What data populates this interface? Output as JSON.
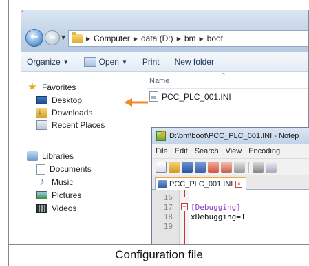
{
  "caption": "Configuration file",
  "explorer": {
    "breadcrumb": [
      "Computer",
      "data (D:)",
      "bm",
      "boot"
    ],
    "toolbar": {
      "organize": "Organize",
      "open": "Open",
      "print": "Print",
      "new_folder": "New folder"
    },
    "nav": {
      "favorites_header": "Favorites",
      "favorites": [
        "Desktop",
        "Downloads",
        "Recent Places"
      ],
      "libraries_header": "Libraries",
      "libraries": [
        "Documents",
        "Music",
        "Pictures",
        "Videos"
      ]
    },
    "columns": {
      "name": "Name"
    },
    "files": [
      "PCC_PLC_001.INI"
    ]
  },
  "notepad": {
    "title": "D:\\bm\\boot\\PCC_PLC_001.INI - Notep",
    "menu": [
      "File",
      "Edit",
      "Search",
      "View",
      "Encoding"
    ],
    "tab": "PCC_PLC_001.INI",
    "lines": [
      {
        "number": "16",
        "text": ""
      },
      {
        "number": "17",
        "text": "[Debugging]"
      },
      {
        "number": "18",
        "text": "xDebugging=1"
      },
      {
        "number": "19",
        "text": ""
      }
    ],
    "highlight_color": "#f08a24"
  }
}
